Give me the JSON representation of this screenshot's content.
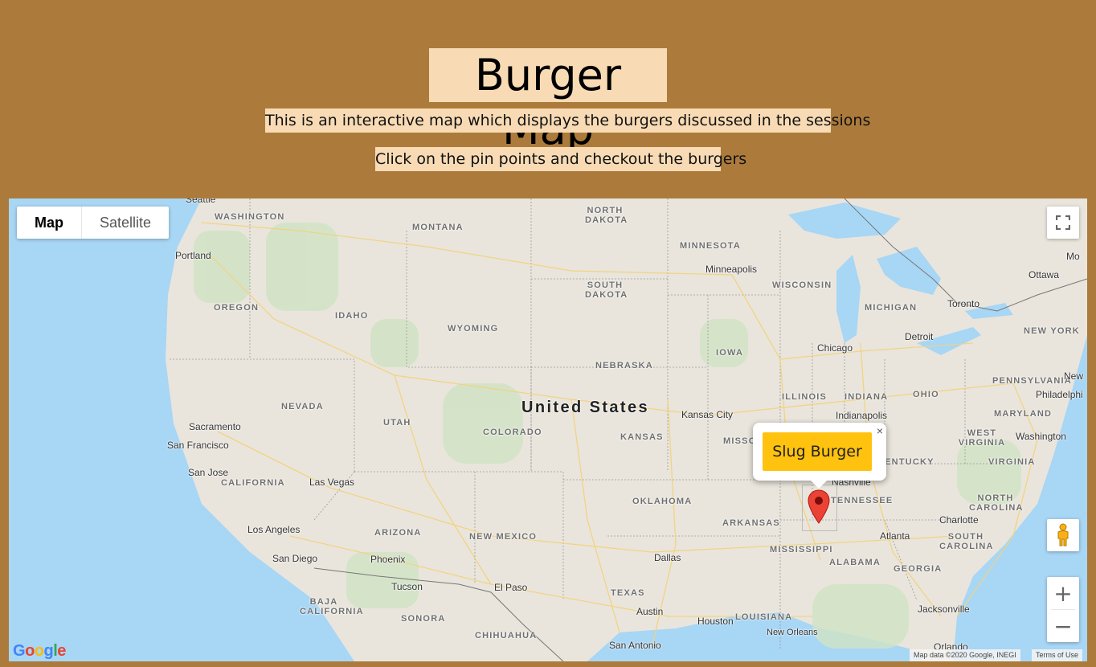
{
  "header": {
    "title": "Burger Map",
    "subtitle1": "This is an interactive map which displays the burgers discussed in the sessions",
    "subtitle2": "Click on the pin points and checkout the burgers"
  },
  "map": {
    "map_type": {
      "map_label": "Map",
      "satellite_label": "Satellite",
      "selected": "Map"
    },
    "country_label": "United States",
    "states": [
      "WASHINGTON",
      "MONTANA",
      "NORTH DAKOTA",
      "MINNESOTA",
      "OREGON",
      "IDAHO",
      "SOUTH DAKOTA",
      "WISCONSIN",
      "MICHIGAN",
      "WYOMING",
      "IOWA",
      "NEBRASKA",
      "NEW YORK",
      "NEVADA",
      "UTAH",
      "ILLINOIS",
      "INDIANA",
      "OHIO",
      "PENNSYLVANIA",
      "COLORADO",
      "KANSAS",
      "MISSO",
      "WEST VIRGINIA",
      "MARYLAND",
      "CALIFORNIA",
      "KENTUCKY",
      "VIRGINIA",
      "OKLAHOMA",
      "ARKANSAS",
      "TENNESSEE",
      "NORTH CAROLINA",
      "ARIZONA",
      "NEW MEXICO",
      "MISSISSIPPI",
      "SOUTH CAROLINA",
      "ALABAMA",
      "GEORGIA",
      "TEXAS",
      "LOUISIANA",
      "BAJA CALIFORNIA",
      "SONORA",
      "CHIHUAHUA"
    ],
    "cities": [
      "Seattle",
      "Portland",
      "Minneapolis",
      "Ottawa",
      "Mo",
      "Toronto",
      "Detroit",
      "Chicago",
      "New",
      "Philadelphi",
      "Indianapolis",
      "Kansas City",
      "Washington",
      "Sacramento",
      "San Francisco",
      "San Jose",
      "Las Vegas",
      "Nashville",
      "Charlotte",
      "Los Angeles",
      "Atlanta",
      "San Diego",
      "Phoenix",
      "Dallas",
      "Tucson",
      "El Paso",
      "Austin",
      "Houston",
      "Jacksonville",
      "New Orleans",
      "San Antonio",
      "Orlando"
    ],
    "info_window": {
      "label": "Slug Burger",
      "close": "×"
    },
    "attribution": {
      "data": "Map data ©2020 Google, INEGI",
      "terms": "Terms of Use"
    },
    "logo_text": "Google",
    "controls": {
      "zoom_in": "+",
      "zoom_out": "−"
    },
    "icons": [
      "fullscreen-icon",
      "pegman-icon",
      "map-marker-icon",
      "close-icon"
    ],
    "colors": {
      "background": "#ac7b3c",
      "highlight": "#f8dbb4",
      "button": "#ffc20e",
      "water": "#a8d6f5",
      "land": "#e9e5dc"
    }
  }
}
